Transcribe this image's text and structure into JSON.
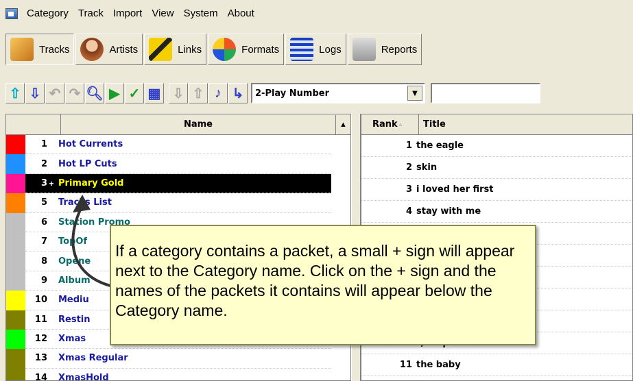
{
  "menu": {
    "items": [
      "Category",
      "Track",
      "Import",
      "View",
      "System",
      "About"
    ]
  },
  "toolbar": {
    "buttons": [
      {
        "label": "Tracks",
        "icon": "tracks-icon"
      },
      {
        "label": "Artists",
        "icon": "artists-icon"
      },
      {
        "label": "Links",
        "icon": "links-icon"
      },
      {
        "label": "Formats",
        "icon": "formats-icon"
      },
      {
        "label": "Logs",
        "icon": "logs-icon"
      },
      {
        "label": "Reports",
        "icon": "reports-icon"
      }
    ]
  },
  "smallbar": {
    "select_value": "2-Play Number",
    "search_value": ""
  },
  "categories": {
    "header": "Name",
    "rows": [
      {
        "num": "1",
        "name": "Hot Currents",
        "color": "#ff0000",
        "plus": "",
        "style": "blue"
      },
      {
        "num": "2",
        "name": "Hot LP Cuts",
        "color": "#1e90ff",
        "plus": "",
        "style": "blue"
      },
      {
        "num": "3",
        "name": "Primary Gold",
        "color": "#ff1493",
        "plus": "+",
        "style": "selected"
      },
      {
        "num": "5",
        "name": "Tracks List",
        "color": "#ff8000",
        "plus": "",
        "style": "blue"
      },
      {
        "num": "6",
        "name": "Station Promo",
        "color": "#c0c0c0",
        "plus": "",
        "style": "teal"
      },
      {
        "num": "7",
        "name": "TopOf",
        "color": "#c0c0c0",
        "plus": "",
        "style": "teal"
      },
      {
        "num": "8",
        "name": "Opene",
        "color": "#c0c0c0",
        "plus": "",
        "style": "teal"
      },
      {
        "num": "9",
        "name": "Album",
        "color": "#c0c0c0",
        "plus": "",
        "style": "teal"
      },
      {
        "num": "10",
        "name": "Mediu",
        "color": "#ffff00",
        "plus": "",
        "style": "blue"
      },
      {
        "num": "11",
        "name": "Restin",
        "color": "#808000",
        "plus": "",
        "style": "blue"
      },
      {
        "num": "12",
        "name": "Xmas",
        "color": "#00ff00",
        "plus": "",
        "style": "blue"
      },
      {
        "num": "13",
        "name": "Xmas Regular",
        "color": "#808000",
        "plus": "",
        "style": "blue"
      },
      {
        "num": "14",
        "name": "XmasHold",
        "color": "#808000",
        "plus": "",
        "style": "blue"
      }
    ]
  },
  "tracks": {
    "rank_header": "Rank",
    "title_header": "Title",
    "rows": [
      {
        "rank": "1",
        "title": "the eagle"
      },
      {
        "rank": "2",
        "title": "skin"
      },
      {
        "rank": "3",
        "title": "i loved her first"
      },
      {
        "rank": "4",
        "title": "stay with me"
      },
      {
        "rank": "",
        "title": ""
      },
      {
        "rank": "",
        "title": ""
      },
      {
        "rank": "",
        "title": "ry"
      },
      {
        "rank": "",
        "title": "ard"
      },
      {
        "rank": "",
        "title": "e"
      },
      {
        "rank": "",
        "title": "t, no problem"
      },
      {
        "rank": "11",
        "title": "the baby"
      }
    ]
  },
  "callout": {
    "text": "If a category contains a packet, a small + sign will appear next to the Category name.  Click on the + sign and the names of the packets it contains will appear below the Category name."
  }
}
